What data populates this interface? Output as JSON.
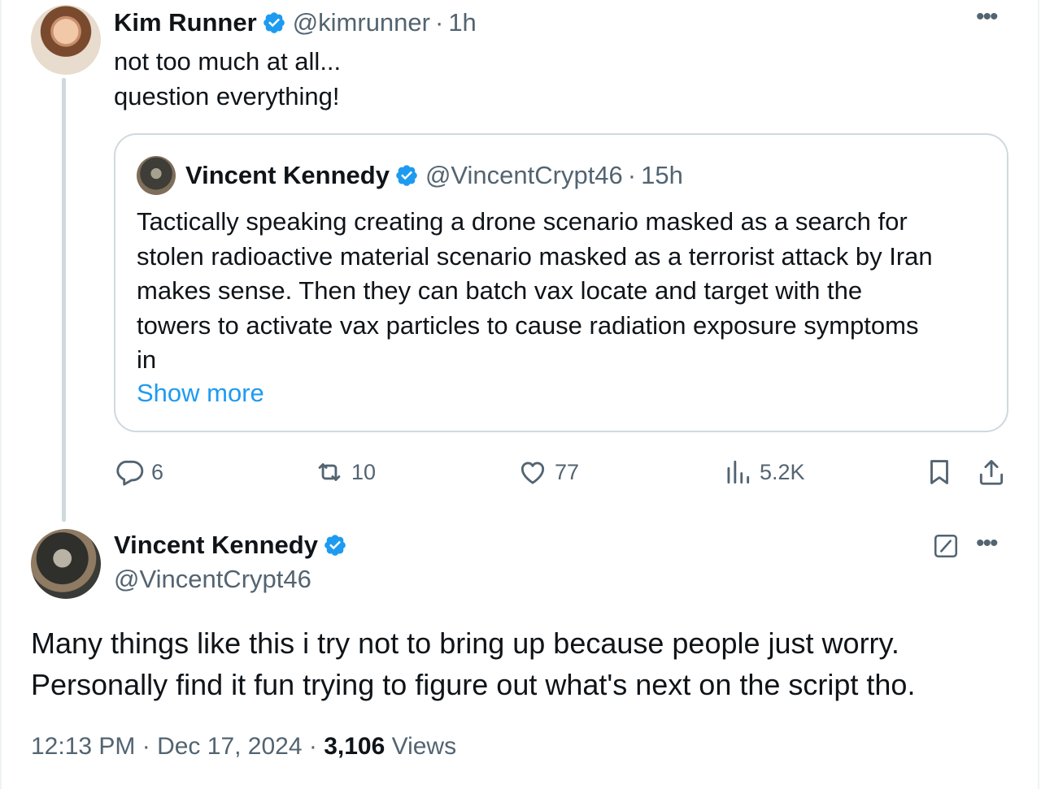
{
  "reply": {
    "author_name": "Kim Runner",
    "author_handle": "@kimrunner",
    "separator": "·",
    "time": "1h",
    "more_label": "•••",
    "text_lines": [
      "not too much at all...",
      "question everything!"
    ],
    "quoted": {
      "author_name": "Vincent Kennedy",
      "author_handle": "@VincentCrypt46",
      "separator": "·",
      "time": "15h",
      "text_lines": [
        "Tactically speaking creating a drone scenario masked as a search for",
        "stolen radioactive material scenario masked as a terrorist attack by Iran",
        "makes sense. Then they can batch vax locate and target with the",
        "towers to activate vax particles to cause radiation exposure symptoms",
        "in"
      ],
      "show_more_label": "Show more"
    },
    "actions": {
      "replies": "6",
      "reposts": "10",
      "likes": "77",
      "views": "5.2K"
    }
  },
  "main_tweet": {
    "author_name": "Vincent Kennedy",
    "author_handle": "@VincentCrypt46",
    "more_label": "•••",
    "text_lines": [
      "Many things like this i try not to bring up because people just worry.",
      "Personally find it fun trying to figure out what's next on the script tho."
    ],
    "timestamp": "12:13 PM · Dec 17, 2024 · ",
    "views_count": "3,106",
    "views_label": " Views"
  },
  "icons": {
    "verified": "verified-badge-icon",
    "reply": "reply-icon",
    "repost": "repost-icon",
    "like": "heart-icon",
    "views": "analytics-icon",
    "bookmark": "bookmark-icon",
    "share": "share-icon",
    "edit": "edit-icon"
  },
  "colors": {
    "accent": "#1d9bf0",
    "secondary_text": "#536471",
    "primary_text": "#0f1419",
    "border": "#cfd9de"
  }
}
